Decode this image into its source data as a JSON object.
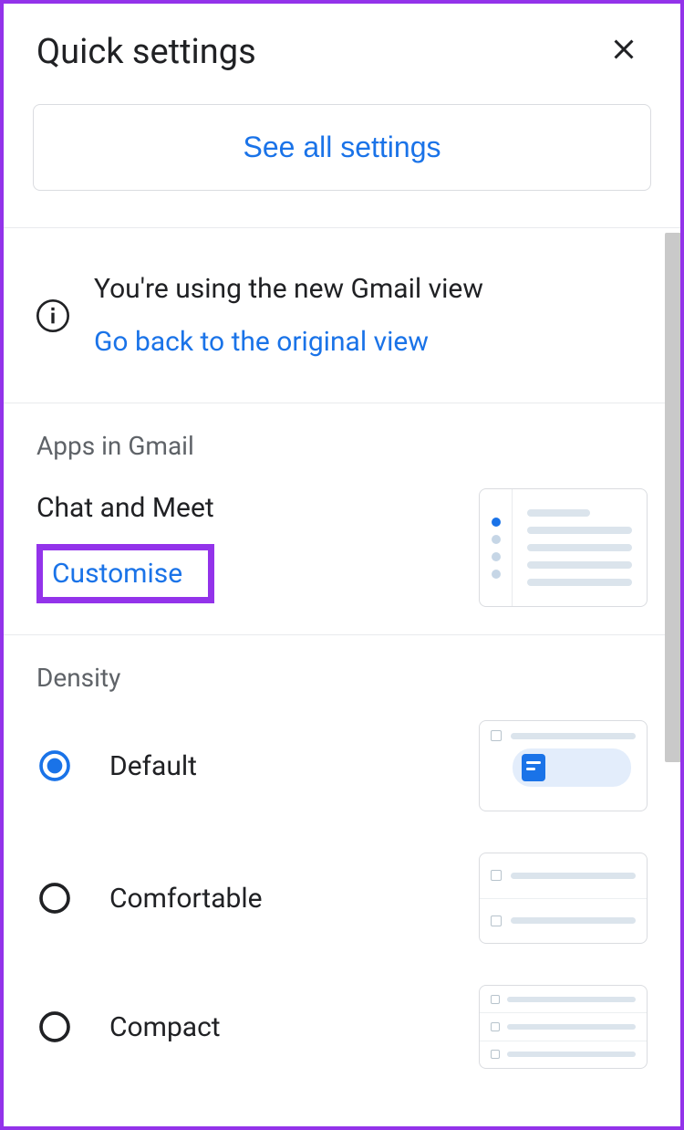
{
  "header": {
    "title": "Quick settings"
  },
  "seeAll": {
    "label": "See all settings"
  },
  "newView": {
    "message": "You're using the new Gmail view",
    "goBackLabel": "Go back to the original view"
  },
  "apps": {
    "title": "Apps in Gmail",
    "heading": "Chat and Meet",
    "customiseLabel": "Customise"
  },
  "density": {
    "title": "Density",
    "options": [
      {
        "label": "Default",
        "selected": true
      },
      {
        "label": "Comfortable",
        "selected": false
      },
      {
        "label": "Compact",
        "selected": false
      }
    ]
  },
  "colors": {
    "accent": "#1a73e8",
    "highlight": "#9333ea"
  }
}
